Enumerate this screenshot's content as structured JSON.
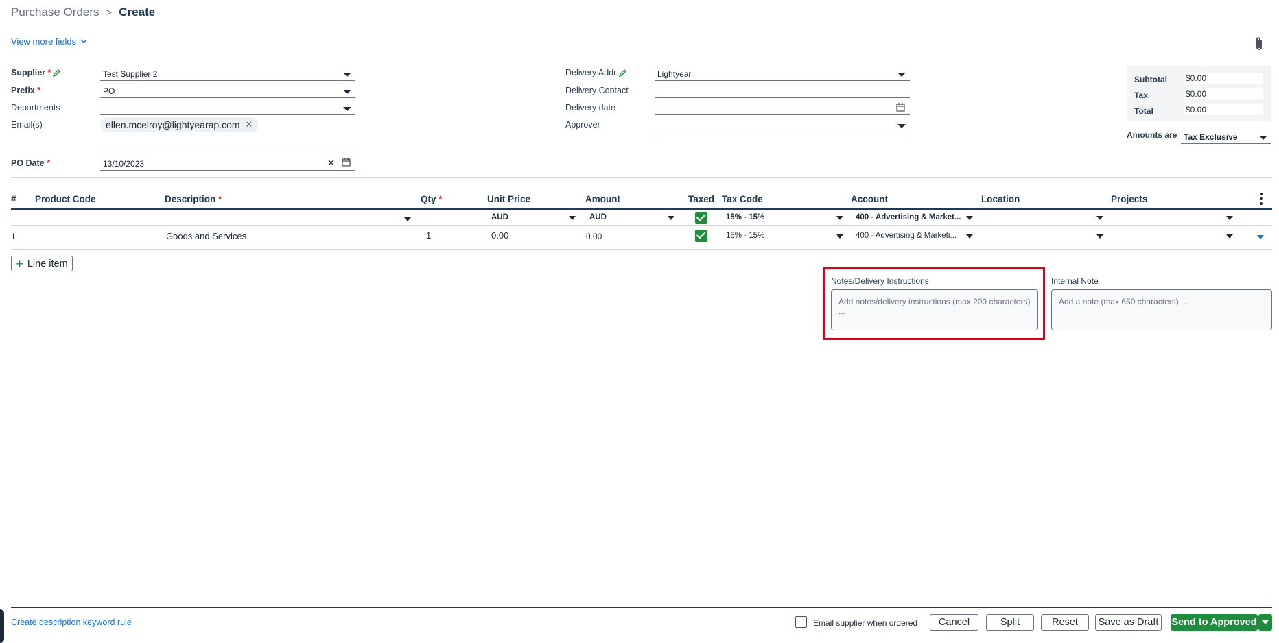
{
  "breadcrumb": {
    "parent": "Purchase Orders",
    "separator": ">",
    "current": "Create"
  },
  "view_more": "View more fields",
  "form_left": {
    "supplier_label": "Supplier",
    "supplier_value": "Test Supplier 2",
    "prefix_label": "Prefix",
    "prefix_value": "PO",
    "departments_label": "Departments",
    "departments_value": "",
    "emails_label": "Email(s)",
    "email_chip": "ellen.mcelroy@lightyearap.com",
    "po_date_label": "PO Date",
    "po_date_value": "13/10/2023",
    "required_mark": "*"
  },
  "form_mid": {
    "delivery_addr_label": "Delivery Addr",
    "delivery_addr_value": "Lightyear",
    "delivery_contact_label": "Delivery Contact",
    "delivery_contact_value": "",
    "delivery_date_label": "Delivery date",
    "delivery_date_value": "",
    "approver_label": "Approver",
    "approver_value": ""
  },
  "totals": {
    "subtotal_label": "Subtotal",
    "subtotal_value": "$0.00",
    "tax_label": "Tax",
    "tax_value": "$0.00",
    "total_label": "Total",
    "total_value": "$0.00",
    "amounts_are_label": "Amounts are",
    "amounts_are_value": "Tax Exclusive"
  },
  "table": {
    "headers": [
      "#",
      "Product Code",
      "Description",
      "Qty",
      "Unit Price",
      "Amount",
      "Taxed",
      "Tax Code",
      "Account",
      "Location",
      "Projects"
    ],
    "defaults": {
      "unit_price_currency": "AUD",
      "amount_currency": "AUD",
      "tax_code": "15% - 15%",
      "account": "400 - Advertising & Market..."
    },
    "rows": [
      {
        "num": "1",
        "product_code": "",
        "description": "Goods and Services",
        "qty": "1",
        "unit_price": "0.00",
        "amount": "0.00",
        "taxed": true,
        "tax_code": "15% - 15%",
        "account": "400 - Advertising & Marketi...",
        "location": "",
        "projects": ""
      }
    ]
  },
  "line_item_button": "Line item",
  "notes": {
    "delivery_label": "Notes/Delivery Instructions",
    "delivery_placeholder": "Add notes/delivery instructions (max 200 characters) ...",
    "internal_label": "Internal Note",
    "internal_placeholder": "Add a note (max 650 characters) ..."
  },
  "footer": {
    "keyword_rule_link": "Create description keyword rule",
    "email_supplier_label": "Email supplier when ordered",
    "cancel": "Cancel",
    "split": "Split",
    "reset": "Reset",
    "save_draft": "Save as Draft",
    "send_approved": "Send to Approved"
  },
  "colors": {
    "accent_green": "#1e8e3e",
    "link_blue": "#1a6fc8",
    "highlight_red": "#e1001a",
    "heading_navy": "#1f3a52"
  }
}
